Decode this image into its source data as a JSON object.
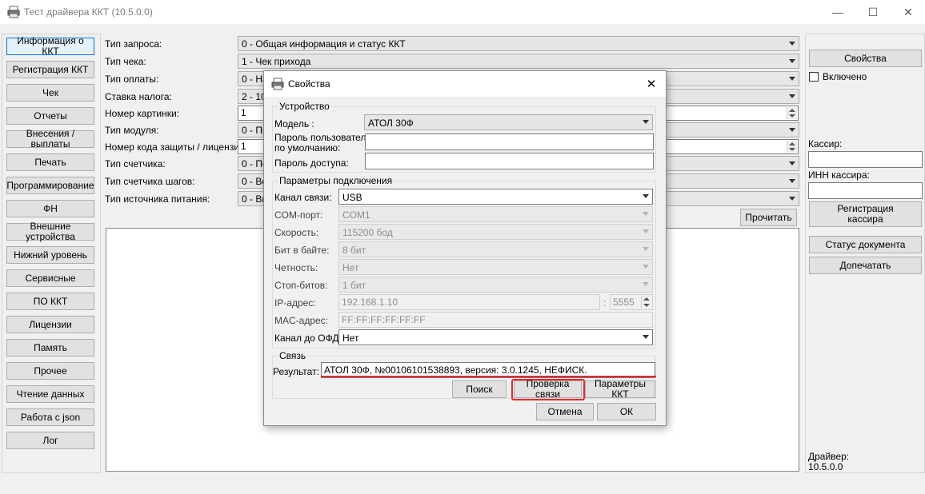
{
  "window": {
    "title": "Тест драйвера ККТ (10.5.0.0)",
    "controls": {
      "minimize": "—",
      "maximize": "☐",
      "close": "✕"
    }
  },
  "sidebar": {
    "items": [
      {
        "label": "Информация о ККТ",
        "active": true
      },
      {
        "label": "Регистрация ККТ"
      },
      {
        "label": "Чек"
      },
      {
        "label": "Отчеты"
      },
      {
        "label": "Внесения / выплаты"
      },
      {
        "label": "Печать"
      },
      {
        "label": "Программирование"
      },
      {
        "label": "ФН"
      },
      {
        "label": "Внешние устройства"
      },
      {
        "label": "Нижний уровень"
      },
      {
        "label": "Сервисные"
      },
      {
        "label": "ПО ККТ"
      },
      {
        "label": "Лицензии"
      },
      {
        "label": "Память"
      },
      {
        "label": "Прочее"
      },
      {
        "label": "Чтение данных"
      },
      {
        "label": "Работа с json"
      },
      {
        "label": "Лог"
      }
    ]
  },
  "main": {
    "fields": [
      {
        "label": "Тип запроса:",
        "value": "0 - Общая информация и статус ККТ"
      },
      {
        "label": "Тип чека:",
        "value": "1 - Чек прихода"
      },
      {
        "label": "Тип оплаты:",
        "value": "0 - На"
      },
      {
        "label": "Ставка налога:",
        "value": "2 - 10"
      },
      {
        "label": "Номер картинки:",
        "value": "1"
      },
      {
        "label": "Тип модуля:",
        "value": "0 - Пр"
      },
      {
        "label": "Номер кода защиты / лицензии:",
        "value": "1"
      },
      {
        "label": "Тип счетчика:",
        "value": "0 - По"
      },
      {
        "label": "Тип счетчика шагов:",
        "value": "0 - Вс"
      },
      {
        "label": "Тип источника питания:",
        "value": "0 - Вн"
      }
    ],
    "read_button": "Прочитать"
  },
  "right_panel": {
    "properties_button": "Свойства",
    "enabled_checkbox": {
      "label": "Включено",
      "checked": false
    },
    "cashier_label": "Кассир:",
    "cashier_value": "",
    "cashier_inn_label": "ИНН кассира:",
    "cashier_inn_value": "",
    "register_cashier_button": "Регистрация кассира",
    "doc_status_button": "Статус документа",
    "reprint_button": "Допечатать",
    "driver_label": "Драйвер:",
    "driver_version": "10.5.0.0"
  },
  "dialog": {
    "title": "Свойства",
    "device_group": {
      "title": "Устройство",
      "model_label": "Модель :",
      "model_value": "АТОЛ 30Ф",
      "user_password_label_1": "Пароль пользователя",
      "user_password_label_2": "по умолчанию:",
      "user_password_value": "",
      "access_password_label": "Пароль доступа:",
      "access_password_value": ""
    },
    "connection_group": {
      "title": "Параметры подключения",
      "channel_label": "Канал связи:",
      "channel_value": "USB",
      "com_port_label": "COM-порт:",
      "com_port_value": "COM1",
      "speed_label": "Скорость:",
      "speed_value": "115200 бод",
      "bits_label": "Бит в байте:",
      "bits_value": "8 бит",
      "parity_label": "Четность:",
      "parity_value": "Нет",
      "stopbits_label": "Стоп-битов:",
      "stopbits_value": "1 бит",
      "ip_label": "IP-адрес:",
      "ip_value": "192.168.1.10",
      "ip_separator": ":",
      "port_value": "5555",
      "mac_label": "MAC-адрес:",
      "mac_value": "FF:FF:FF:FF:FF:FF",
      "ofd_channel_label": "Канал до ОФД:",
      "ofd_channel_value": "Нет"
    },
    "link_group": {
      "title": "Связь",
      "result_label": "Результат:",
      "result_value": "АТОЛ 30Ф, №00106101538893, версия: 3.0.1245, НЕФИСК.",
      "search_button": "Поиск",
      "check_button": "Проверка связи",
      "kkt_params_button": "Параметры ККТ"
    },
    "cancel_button": "Отмена",
    "ok_button": "ОК",
    "highlight_color": "#e8262b"
  }
}
